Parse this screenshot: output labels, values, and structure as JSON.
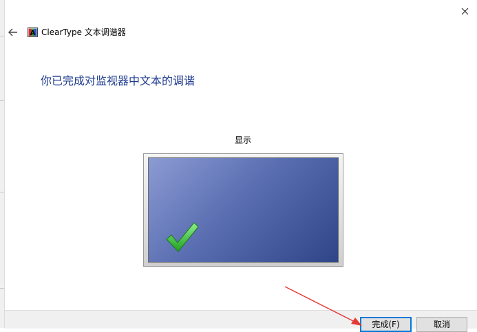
{
  "window": {
    "title": "ClearType 文本调谐器",
    "app_icon": "cleartype-icon",
    "back_icon": "back-arrow-icon",
    "close_icon": "close-icon"
  },
  "main": {
    "heading": "你已完成对监视器中文本的调谐",
    "display_label": "显示",
    "check_icon": "checkmark-icon"
  },
  "footer": {
    "finish_label": "完成(F)",
    "cancel_label": "取消"
  },
  "colors": {
    "heading": "#1f3b8f",
    "screen_light": "#8b9bd3",
    "screen_dark": "#2e4587",
    "check": "#3cc43c",
    "annotation_arrow": "#e53935"
  }
}
